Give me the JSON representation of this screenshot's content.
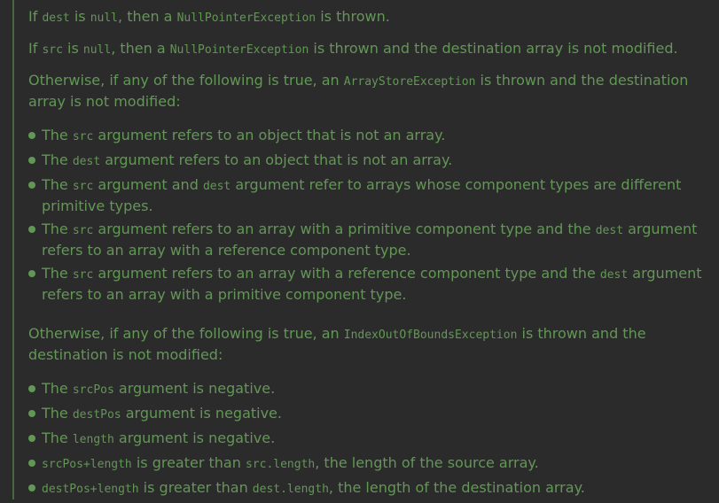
{
  "doc": {
    "p1": {
      "a": "If ",
      "c1": "dest",
      "b": " is ",
      "c2": "null",
      "c": ", then a ",
      "c3": "NullPointerException",
      "d": " is thrown."
    },
    "p2": {
      "a": "If ",
      "c1": "src",
      "b": " is ",
      "c2": "null",
      "c": ", then a ",
      "c3": "NullPointerException",
      "d": " is thrown and the destination array is not modified."
    },
    "p3": {
      "a": "Otherwise, if any of the following is true, an ",
      "c1": "ArrayStoreException",
      "b": " is thrown and the destination array is not modified:"
    },
    "list1": [
      {
        "a": "The ",
        "c1": "src",
        "b": " argument refers to an object that is not an array."
      },
      {
        "a": "The ",
        "c1": "dest",
        "b": " argument refers to an object that is not an array."
      },
      {
        "a": "The ",
        "c1": "src",
        "b": " argument and ",
        "c2": "dest",
        "c": " argument refer to arrays whose component types are different primitive types."
      },
      {
        "a": "The ",
        "c1": "src",
        "b": " argument refers to an array with a primitive component type and the ",
        "c2": "dest",
        "c": " argument refers to an array with a reference component type."
      },
      {
        "a": "The ",
        "c1": "src",
        "b": " argument refers to an array with a reference component type and the ",
        "c2": "dest",
        "c": " argument refers to an array with a primitive component type."
      }
    ],
    "p4": {
      "a": "Otherwise, if any of the following is true, an ",
      "c1": "IndexOutOfBoundsException",
      "b": " is thrown and the destination is not modified:"
    },
    "list2": [
      {
        "a": "The ",
        "c1": "srcPos",
        "b": " argument is negative."
      },
      {
        "a": "The ",
        "c1": "destPos",
        "b": " argument is negative."
      },
      {
        "a": "The ",
        "c1": "length",
        "b": " argument is negative."
      },
      {
        "c1": "srcPos+length",
        "b": " is greater than ",
        "c2": "src.length",
        "c": ", the length of the source array."
      },
      {
        "c1": "destPos+length",
        "b": " is greater than ",
        "c2": "dest.length",
        "c": ", the length of the destination array."
      }
    ]
  },
  "colors": {
    "background": "#2b2b2b",
    "doc_text": "#629755"
  }
}
